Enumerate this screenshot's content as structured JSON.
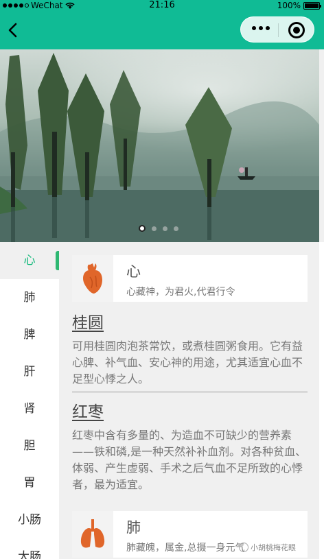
{
  "status_bar": {
    "carrier": "WeChat",
    "time": "21:16",
    "battery": "100%"
  },
  "nav": {
    "back_icon": "chevron-left-icon",
    "more_icon": "more-dots-icon",
    "close_icon": "target-close-icon"
  },
  "banner": {
    "image": "misty lake with trees and a small boat",
    "indicator_count": 4,
    "active_index": 0
  },
  "sidebar": {
    "items": [
      {
        "label": "心"
      },
      {
        "label": "肺"
      },
      {
        "label": "脾"
      },
      {
        "label": "肝"
      },
      {
        "label": "肾"
      },
      {
        "label": "胆"
      },
      {
        "label": "胃"
      },
      {
        "label": "小肠"
      },
      {
        "label": "大肠"
      }
    ],
    "active_index": 0
  },
  "content": {
    "organs": [
      {
        "name": "心",
        "desc": "心藏神，为君火,代君行令",
        "icon": "heart-icon",
        "foods": [
          {
            "title": "桂圆",
            "text": "可用桂圆肉泡茶常饮，或煮桂圆粥食用。它有益心脾、补气血、安心神的用途，尤其适宜心血不足型心悸之人。"
          },
          {
            "title": "红枣",
            "text": "红枣中含有多量的、为造血不可缺少的营养素——铁和磷,是一种天然补补血剂。对各种贫血、体弱、产生虚弱、手术之后气血不足所致的心悸者，最为适宜。"
          }
        ]
      },
      {
        "name": "肺",
        "desc": "肺藏魄，属金,总摄一身元气",
        "icon": "lungs-icon"
      }
    ]
  },
  "watermark": "小胡桃梅花眼",
  "colors": {
    "header": "#10bb95",
    "active_text": "#10b97a",
    "active_bar": "#2eb872",
    "organ_icon": "#e0662a"
  }
}
